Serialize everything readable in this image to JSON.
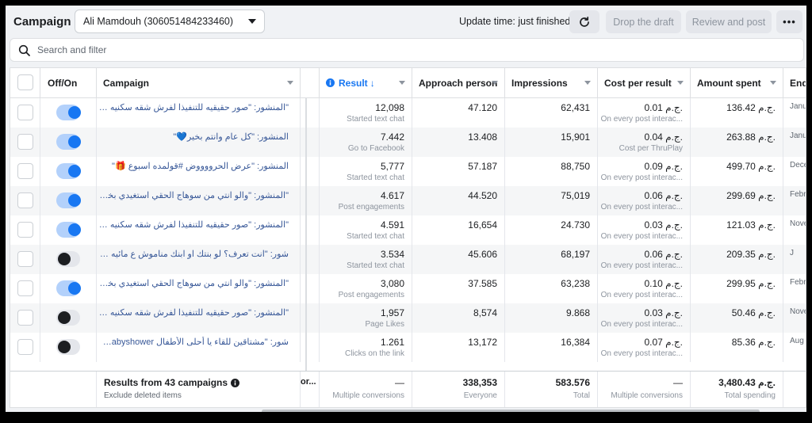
{
  "header": {
    "title": "Campaign",
    "account": "Ali Mamdouh (306051484233460)",
    "update_time": "Update time: just finished",
    "drop_draft": "Drop the draft",
    "review_post": "Review and post",
    "more": "•••"
  },
  "search": {
    "placeholder": "Search and filter"
  },
  "columns": {
    "off_on": "Off/On",
    "campaign": "Campaign",
    "result": "Result",
    "approach": "Approach person",
    "impressions": "Impressions",
    "cost": "Cost per result",
    "amount": "Amount spent",
    "end": "End"
  },
  "rows": [
    {
      "on": true,
      "name": "\"المنشور: \"صور حقيقيه للتنفيذا لفرش شقه سكنيه بمدينه المحله...",
      "result": "12,098",
      "result_sub": "Started text chat",
      "approach": "47.120",
      "impr": "62,431",
      "cost": "0.01 ج.م.",
      "cost_sub": "On every post interac...",
      "amount": "136.42 ج.م.",
      "end": "Janu"
    },
    {
      "on": true,
      "name": "المنشور: \"كل عام وانتم بخير💙\"",
      "result": "7.442",
      "result_sub": "Go to Facebook",
      "approach": "13.408",
      "impr": "15,901",
      "cost": "0.04 ج.م.",
      "cost_sub": "Cost per ThruPlay",
      "amount": "263.88 ج.م.",
      "end": "Janu"
    },
    {
      "on": true,
      "name": "المنشور: \"عرض الحرووووض #قولمده اسبوع 🎁\"",
      "result": "5,777",
      "result_sub": "Started text chat",
      "approach": "57.187",
      "impr": "88,750",
      "cost": "0.09 ج.م.",
      "cost_sub": "On every post interac...",
      "amount": "499.70 ج.م.",
      "end": "Dece"
    },
    {
      "on": true,
      "name": "\"المنشور: \"والو انتي من سوهاج الحقي استغيدي بخصم المصنع...",
      "result": "4.617",
      "result_sub": "Post engagements",
      "approach": "44.520",
      "impr": "75,019",
      "cost": "0.06 ج.م.",
      "cost_sub": "On every post interac...",
      "amount": "299.69 ج.م.",
      "end": "Febr"
    },
    {
      "on": true,
      "name": "\"المنشور: \"صور حقيقيه للتنفيذا لفرش شقه سكنيه بمدينه المحله...",
      "result": "4.591",
      "result_sub": "Started text chat",
      "approach": "16,654",
      "impr": "24.730",
      "cost": "0.03 ج.م.",
      "cost_sub": "On every post interac...",
      "amount": "121.03 ج.م.",
      "end": "Nove"
    },
    {
      "on": false,
      "name": "شور: \"انت تعرف؟ لو بنتك او ابنك مناموش ع مائيه قطن ايه...",
      "result": "3.534",
      "result_sub": "Started text chat",
      "approach": "45.606",
      "impr": "68,197",
      "cost": "0.06 ج.م.",
      "cost_sub": "On every post interac...",
      "amount": "209.35 ج.م.",
      "end": "J"
    },
    {
      "on": true,
      "name": "\"المنشور: \"والو انتي من سوهاج الحقي استغيدي بخصم المصنع...",
      "result": "3,080",
      "result_sub": "Post engagements",
      "approach": "37.585",
      "impr": "63,238",
      "cost": "0.10 ج.م.",
      "cost_sub": "On every post interac...",
      "amount": "299.95 ج.م.",
      "end": "Febr"
    },
    {
      "on": false,
      "name": "\"المنشور: \"صور حقيقيه للتنفيذا لفرش شقه سكنيه بمدينه المحله...",
      "result": "1,957",
      "result_sub": "Page Likes",
      "approach": "8,574",
      "impr": "9.868",
      "cost": "0.03 ج.م.",
      "cost_sub": "On every post interac...",
      "amount": "50.46 ج.م.",
      "end": "Nove"
    },
    {
      "on": false,
      "name": "شور: \"مشتاقين للقاء يا أحلى الأطفال babyshower#...\"",
      "result": "1.261",
      "result_sub": "Clicks on the link",
      "approach": "13,172",
      "impr": "16,384",
      "cost": "0.07 ج.م.",
      "cost_sub": "On every post interac...",
      "amount": "85.36 ج.م.",
      "end": "Aug"
    }
  ],
  "footer": {
    "results_title": "Results from 43 campaigns",
    "exclude": "Exclude deleted items",
    "partial": "or...",
    "result_dash": "—",
    "result_sub": "Multiple conversions",
    "approach": "338,353",
    "approach_sub": "Everyone",
    "impr": "583.576",
    "impr_sub": "Total",
    "cost_dash": "—",
    "cost_sub": "Multiple conversions",
    "amount": "3,480.43 ج.م.",
    "amount_sub": "Total spending"
  }
}
